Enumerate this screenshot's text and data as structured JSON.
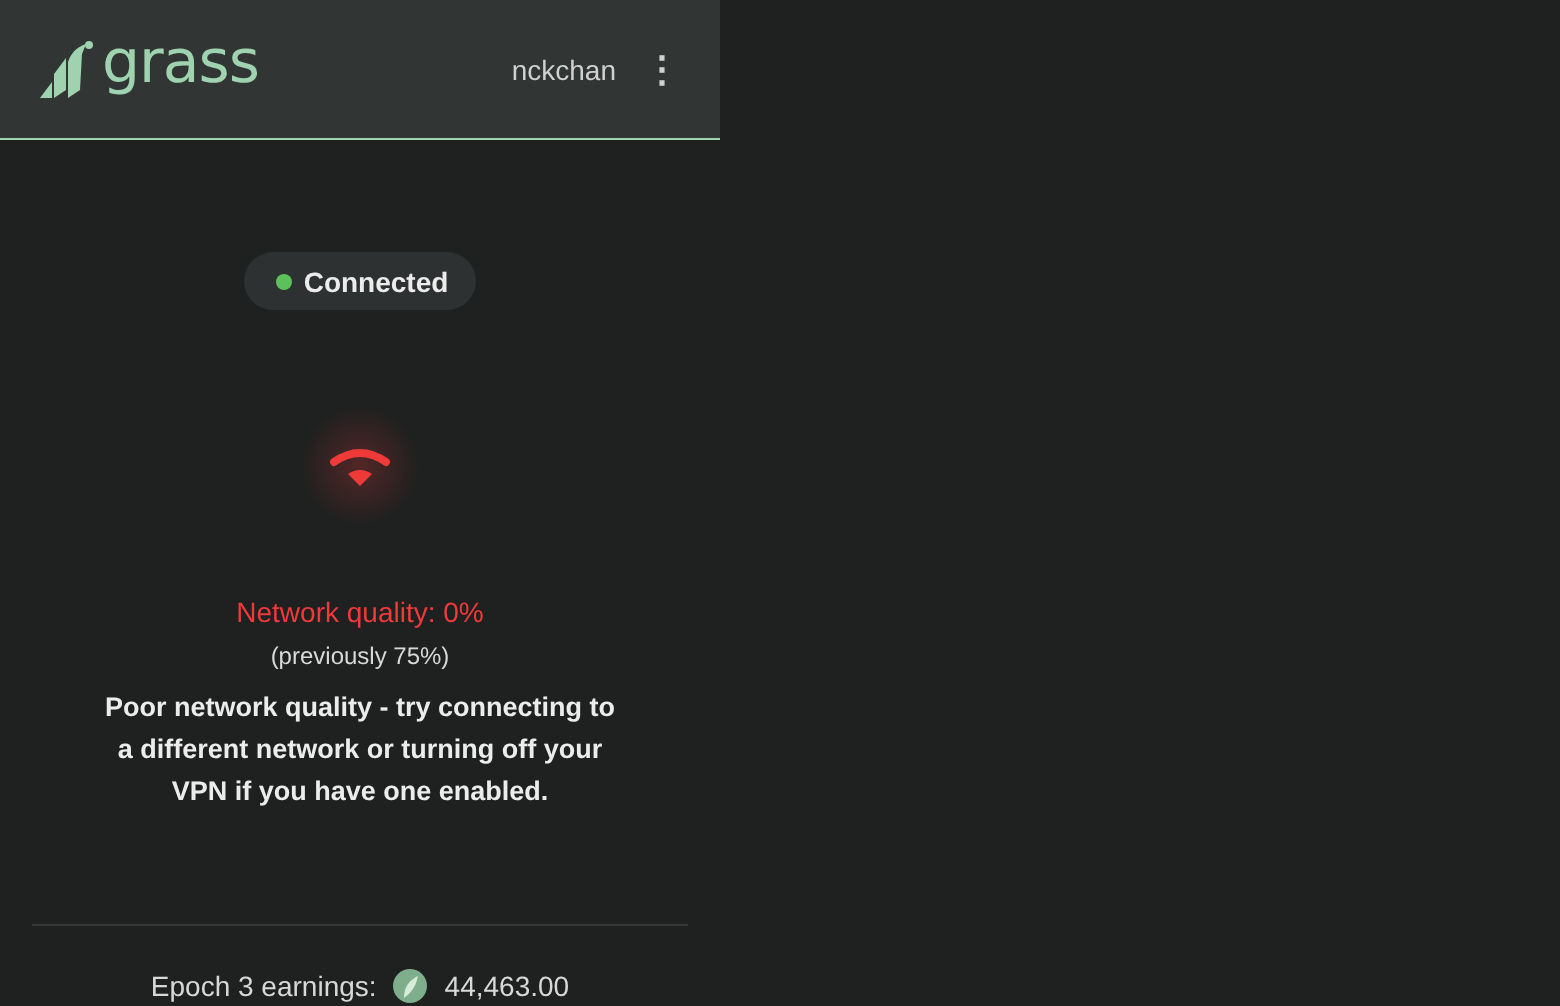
{
  "header": {
    "logo_text": "grass",
    "username": "nckchan",
    "menu_icon": "⋮"
  },
  "status": {
    "label": "Connected",
    "color": "#5cc15a"
  },
  "network": {
    "quality": "Network quality: 0%",
    "previous": "(previously 75%)",
    "message": "Poor network quality - try connecting to a different network or turning off your VPN if you have one enabled.",
    "color": "#f03a3a"
  },
  "earnings": {
    "label": "Epoch 3 earnings:",
    "amount": "44,463.00"
  }
}
